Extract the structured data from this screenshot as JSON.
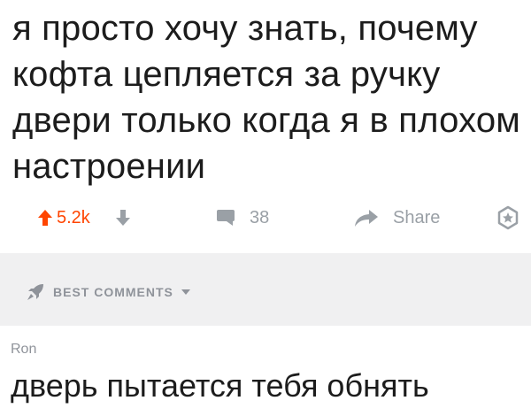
{
  "post": {
    "title": "я просто хочу знать, почему кофта цепляется за ручку двери только когда я в плохом настроении",
    "score": "5.2k",
    "comments_count": "38",
    "share_label": "Share"
  },
  "comments_section": {
    "sort_label": "BEST COMMENTS"
  },
  "top_comment": {
    "author": "Ron",
    "text": "дверь пытается тебя обнять"
  },
  "colors": {
    "upvote": "#ff4500",
    "icon_gray": "#9aa0a6",
    "band": "#f0f0f1"
  },
  "icons": [
    "upvote-arrow-icon",
    "downvote-arrow-icon",
    "comment-bubble-icon",
    "share-arrow-icon",
    "award-icon",
    "rocket-icon",
    "chevron-down-icon"
  ]
}
